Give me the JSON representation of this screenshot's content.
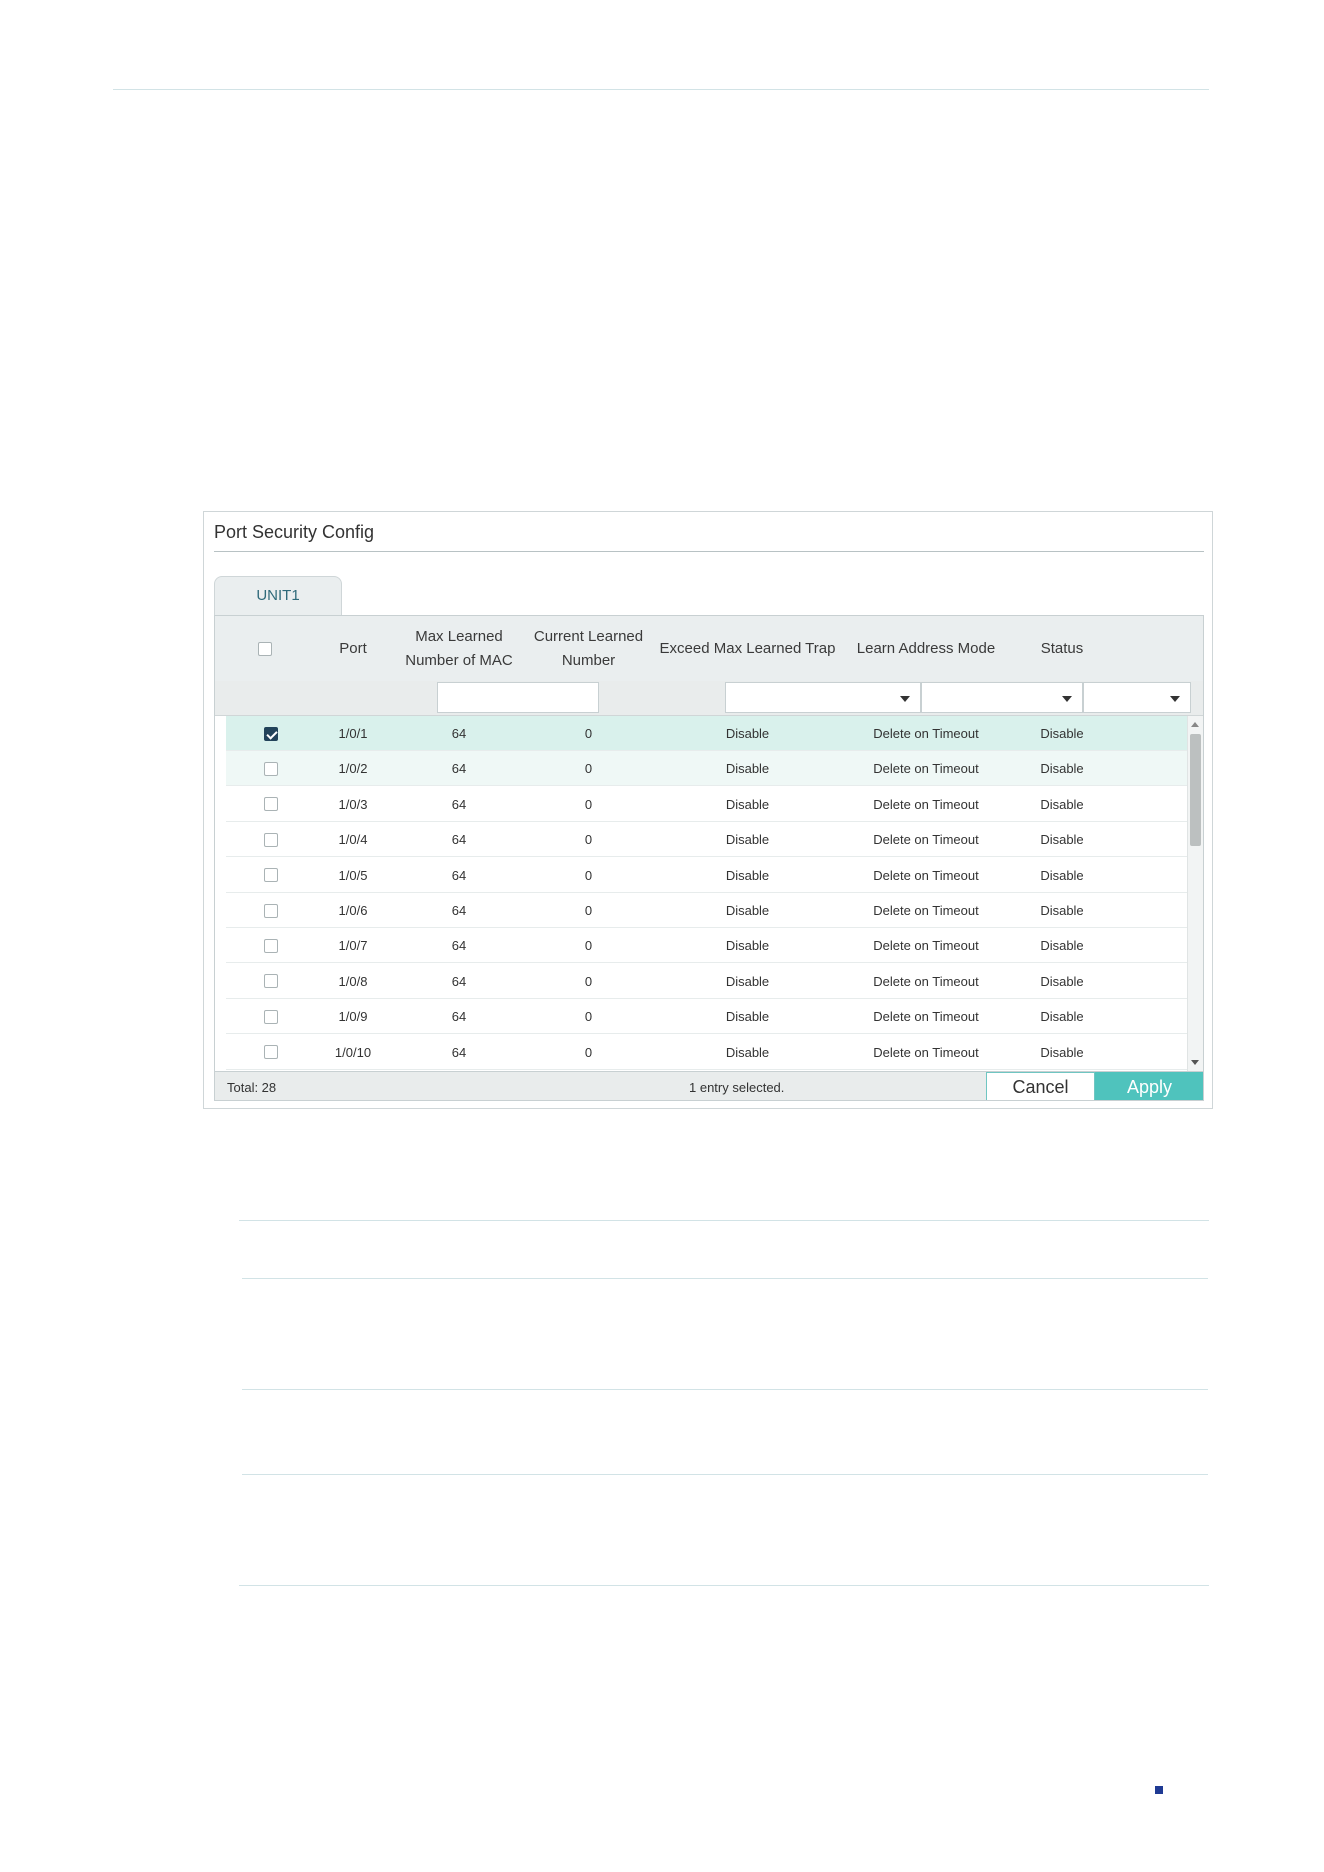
{
  "panel": {
    "title": "Port Security Config",
    "tab_label": "UNIT1"
  },
  "table": {
    "columns": [
      "Port",
      "Max Learned Number of MAC",
      "Current Learned Number",
      "Exceed Max Learned Trap",
      "Learn Address Mode",
      "Status"
    ],
    "rows": [
      {
        "port": "1/0/1",
        "max": "64",
        "current": "0",
        "trap": "Disable",
        "mode": "Delete on Timeout",
        "status": "Disable",
        "checked": true
      },
      {
        "port": "1/0/2",
        "max": "64",
        "current": "0",
        "trap": "Disable",
        "mode": "Delete on Timeout",
        "status": "Disable",
        "checked": false
      },
      {
        "port": "1/0/3",
        "max": "64",
        "current": "0",
        "trap": "Disable",
        "mode": "Delete on Timeout",
        "status": "Disable",
        "checked": false
      },
      {
        "port": "1/0/4",
        "max": "64",
        "current": "0",
        "trap": "Disable",
        "mode": "Delete on Timeout",
        "status": "Disable",
        "checked": false
      },
      {
        "port": "1/0/5",
        "max": "64",
        "current": "0",
        "trap": "Disable",
        "mode": "Delete on Timeout",
        "status": "Disable",
        "checked": false
      },
      {
        "port": "1/0/6",
        "max": "64",
        "current": "0",
        "trap": "Disable",
        "mode": "Delete on Timeout",
        "status": "Disable",
        "checked": false
      },
      {
        "port": "1/0/7",
        "max": "64",
        "current": "0",
        "trap": "Disable",
        "mode": "Delete on Timeout",
        "status": "Disable",
        "checked": false
      },
      {
        "port": "1/0/8",
        "max": "64",
        "current": "0",
        "trap": "Disable",
        "mode": "Delete on Timeout",
        "status": "Disable",
        "checked": false
      },
      {
        "port": "1/0/9",
        "max": "64",
        "current": "0",
        "trap": "Disable",
        "mode": "Delete on Timeout",
        "status": "Disable",
        "checked": false
      },
      {
        "port": "1/0/10",
        "max": "64",
        "current": "0",
        "trap": "Disable",
        "mode": "Delete on Timeout",
        "status": "Disable",
        "checked": false
      }
    ]
  },
  "footer": {
    "total": "Total: 28",
    "selection": "1 entry selected.",
    "cancel_label": "Cancel",
    "apply_label": "Apply"
  },
  "colors": {
    "accent": "#4fc3bd",
    "selected_row": "#d9f1ec",
    "checkbox_checked": "#22435a"
  }
}
